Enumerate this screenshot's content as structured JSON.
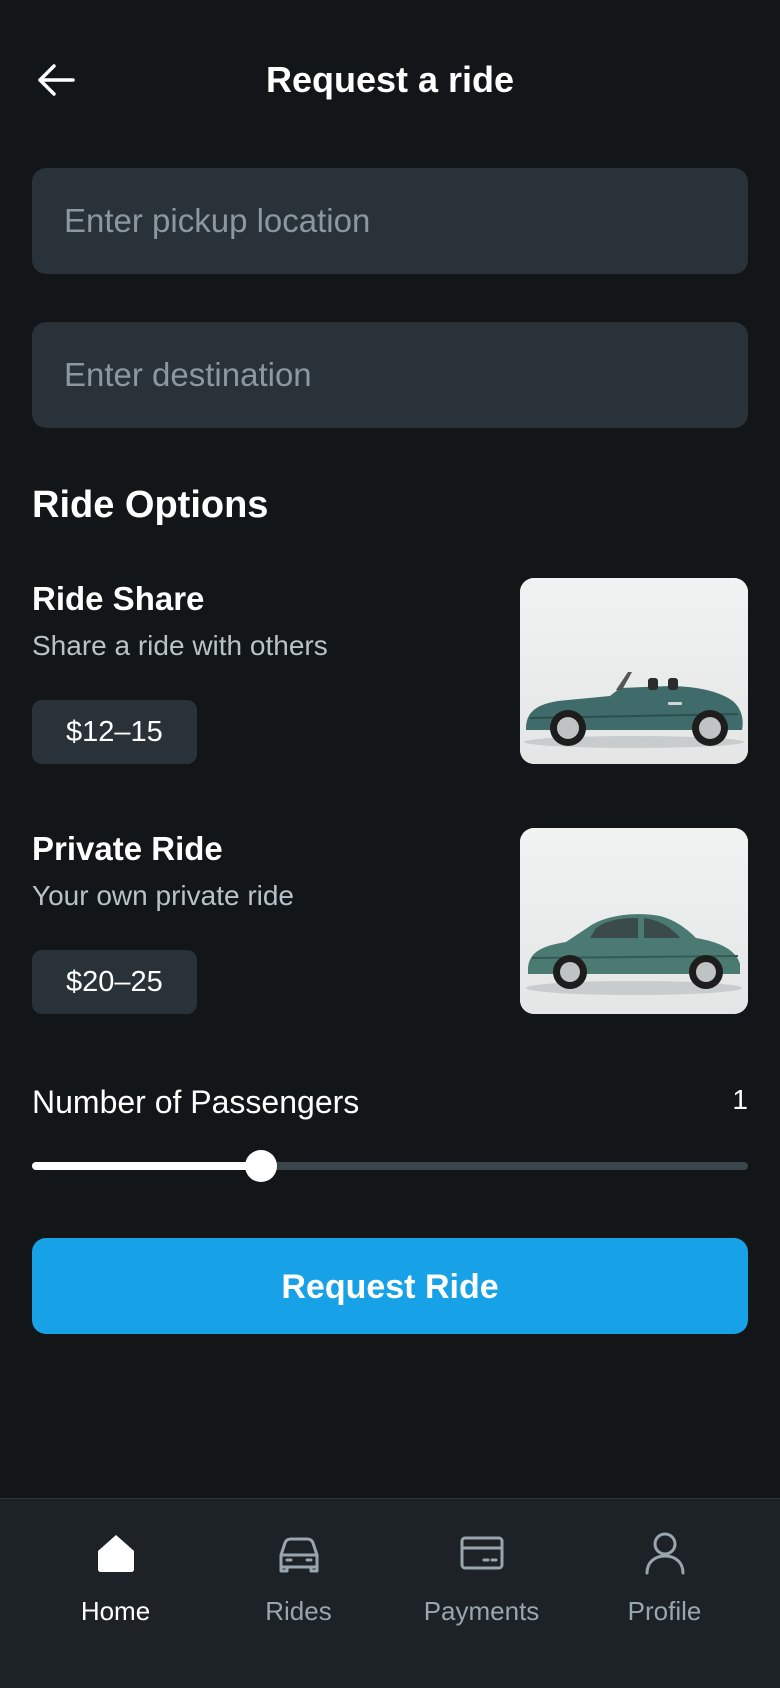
{
  "header": {
    "title": "Request a ride",
    "back_icon": "arrow-left-icon"
  },
  "form": {
    "pickup_placeholder": "Enter pickup location",
    "pickup_value": "",
    "destination_placeholder": "Enter destination",
    "destination_value": ""
  },
  "ride_options": {
    "title": "Ride Options",
    "items": [
      {
        "name": "Ride Share",
        "description": "Share a ride with others",
        "price": "$12–15",
        "image": "green-convertible-car"
      },
      {
        "name": "Private Ride",
        "description": "Your own private ride",
        "price": "$20–25",
        "image": "green-coupe-car"
      }
    ]
  },
  "passengers": {
    "label": "Number of Passengers",
    "value": "1",
    "slider_fraction": 0.32
  },
  "request_button": {
    "label": "Request Ride",
    "color": "#17a2e8"
  },
  "bottom_nav": {
    "items": [
      {
        "label": "Home",
        "icon": "home-icon",
        "active": true
      },
      {
        "label": "Rides",
        "icon": "car-icon",
        "active": false
      },
      {
        "label": "Payments",
        "icon": "credit-card-icon",
        "active": false
      },
      {
        "label": "Profile",
        "icon": "user-icon",
        "active": false
      }
    ]
  },
  "colors": {
    "background": "#121619",
    "surface": "#283238",
    "accent": "#17a2e8"
  }
}
